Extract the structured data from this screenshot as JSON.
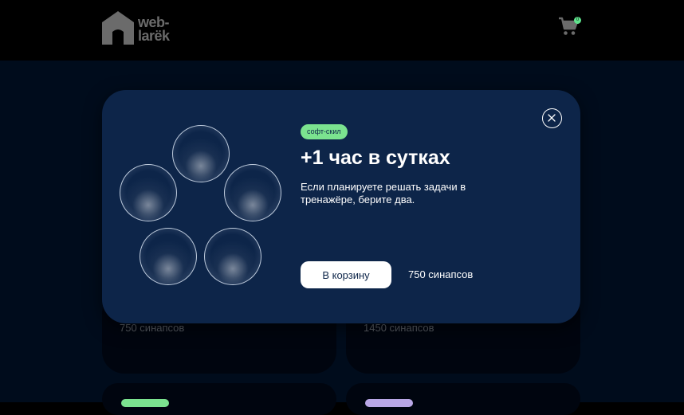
{
  "header": {
    "logo_text": "web-\nlarëk",
    "cart_icon": "shopping-cart-icon",
    "cart_count": "0"
  },
  "gallery": {
    "cards": [
      {
        "price": "750 синапсов",
        "tag_color": "#7be38f"
      },
      {
        "price": "1450 синапсов",
        "tag_color": "#b9a7e6"
      }
    ]
  },
  "modal": {
    "category": "софт-скил",
    "category_color": "#7be38f",
    "title": "+1 час в сутках",
    "description": "Если планируете решать задачи в тренажёре, берите два.",
    "buy_label": "В корзину",
    "price": "750 синапсов",
    "close_icon": "close-icon",
    "background": "#0d2549"
  }
}
